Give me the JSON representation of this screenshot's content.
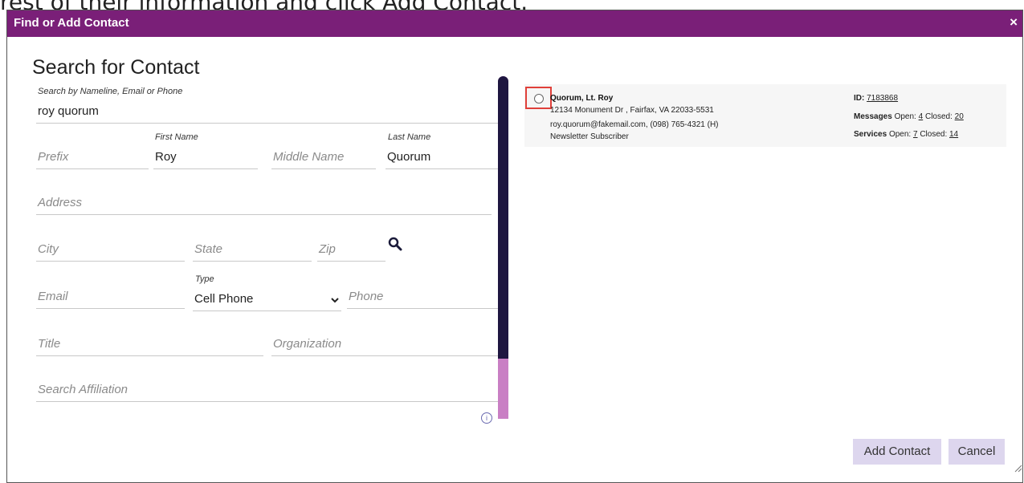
{
  "background_text": "rest of their information and click Add Contact.",
  "dialog": {
    "title": "Find or Add Contact",
    "close_label": "×"
  },
  "search": {
    "heading": "Search for Contact",
    "nameline_label": "Search by Nameline, Email or Phone",
    "nameline_value": "roy quorum",
    "prefix_placeholder": "Prefix",
    "first_name_label": "First Name",
    "first_name_value": "Roy",
    "middle_name_placeholder": "Middle Name",
    "last_name_label": "Last Name",
    "last_name_value": "Quorum",
    "address_placeholder": "Address",
    "city_placeholder": "City",
    "state_placeholder": "State",
    "zip_placeholder": "Zip",
    "email_placeholder": "Email",
    "type_label": "Type",
    "type_value": "Cell Phone",
    "phone_placeholder": "Phone",
    "title_placeholder": "Title",
    "organization_placeholder": "Organization",
    "affiliation_placeholder": "Search Affiliation"
  },
  "result": {
    "name": "Quorum, Lt. Roy",
    "address": "12134 Monument Dr , Fairfax, VA 22033-5531",
    "contact": "roy.quorum@fakemail.com, (098) 765-4321 (H)",
    "tag": "Newsletter Subscriber",
    "id_label": "ID:",
    "id_value": "7183868",
    "messages_label": "Messages",
    "messages_open_label": "Open:",
    "messages_open": "4",
    "messages_closed_label": "Closed:",
    "messages_closed": "20",
    "services_label": "Services",
    "services_open_label": "Open:",
    "services_open": "7",
    "services_closed_label": "Closed:",
    "services_closed": "14"
  },
  "buttons": {
    "add_contact": "Add Contact",
    "cancel": "Cancel"
  },
  "colors": {
    "titlebar": "#7a1f78",
    "button_bg": "#ddd6ee",
    "scroll_thumb": "#1e1640",
    "scroll_track": "#c97fc4",
    "highlight_box": "#e0403a"
  }
}
